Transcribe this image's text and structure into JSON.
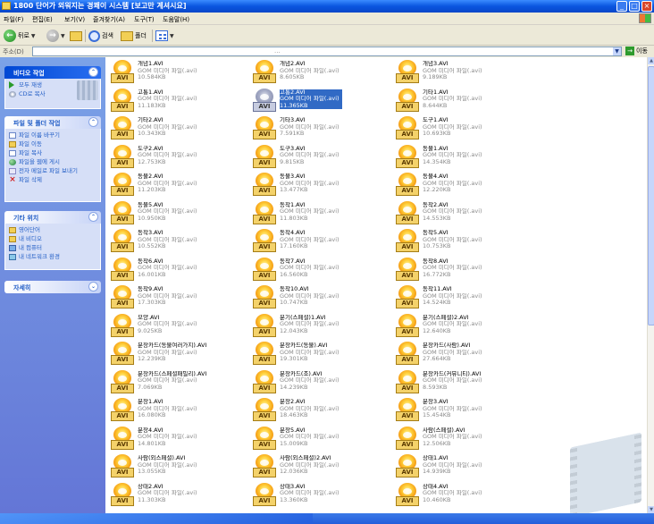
{
  "window": {
    "title": "1800 단어가 외워지는 경쾌이 시스템 [보고만 계셔시요]",
    "controls": [
      "_",
      "□",
      "×"
    ]
  },
  "menu": [
    "파일(F)",
    "편집(E)",
    "보기(V)",
    "즐겨찾기(A)",
    "도구(T)",
    "도움말(H)"
  ],
  "toolbar": {
    "back": "뒤로",
    "search": "검색",
    "folders": "폴더"
  },
  "address": {
    "label": "주소(D)",
    "value": "...",
    "go": "이동"
  },
  "taskpane": {
    "video_tasks": {
      "title": "비디오 작업",
      "items": [
        "모두 재생",
        "CD로 복사"
      ]
    },
    "file_tasks": {
      "title": "파일 및 폴더 작업",
      "items": [
        "파일 이름 바꾸기",
        "파일 이동",
        "파일 복사",
        "파일을 웹에 게시",
        "전자 메일로 파일 보내기",
        "파일 삭제"
      ]
    },
    "other_places": {
      "title": "기타 위치",
      "items": [
        "영어단어",
        "내 비디오",
        "내 컴퓨터",
        "내 네트워크 환경"
      ]
    },
    "details": {
      "title": "자세히"
    }
  },
  "file_type": "GOM 미디어 파일(.avi)",
  "icon_label": "AVI",
  "files": [
    {
      "name": "개념1.AVI",
      "size": "10.584KB"
    },
    {
      "name": "개념2.AVI",
      "size": "8.605KB"
    },
    {
      "name": "개념3.AVI",
      "size": "9.189KB"
    },
    {
      "name": "고통1.AVI",
      "size": "11.183KB"
    },
    {
      "name": "고통2.AVI",
      "size": "11.365KB",
      "selected": true
    },
    {
      "name": "기타1.AVI",
      "size": "8.644KB"
    },
    {
      "name": "기타2.AVI",
      "size": "10.343KB"
    },
    {
      "name": "기타3.AVI",
      "size": "7.591KB"
    },
    {
      "name": "도구1.AVI",
      "size": "10.693KB"
    },
    {
      "name": "도구2.AVI",
      "size": "12.753KB"
    },
    {
      "name": "도구3.AVI",
      "size": "9.815KB"
    },
    {
      "name": "동물1.AVI",
      "size": "14.354KB"
    },
    {
      "name": "동물2.AVI",
      "size": "11.203KB"
    },
    {
      "name": "동물3.AVI",
      "size": "13.477KB"
    },
    {
      "name": "동물4.AVI",
      "size": "12.220KB"
    },
    {
      "name": "동물5.AVI",
      "size": "10.950KB"
    },
    {
      "name": "동작1.AVI",
      "size": "11.803KB"
    },
    {
      "name": "동작2.AVI",
      "size": "14.553KB"
    },
    {
      "name": "동작3.AVI",
      "size": "10.552KB"
    },
    {
      "name": "동작4.AVI",
      "size": "17.160KB"
    },
    {
      "name": "동작5.AVI",
      "size": "10.753KB"
    },
    {
      "name": "동작6.AVI",
      "size": "16.001KB"
    },
    {
      "name": "동작7.AVI",
      "size": "16.560KB"
    },
    {
      "name": "동작8.AVI",
      "size": "16.772KB"
    },
    {
      "name": "동작9.AVI",
      "size": "17.303KB"
    },
    {
      "name": "동작10.AVI",
      "size": "10.747KB"
    },
    {
      "name": "동작11.AVI",
      "size": "14.524KB"
    },
    {
      "name": "모양.AVI",
      "size": "9.025KB"
    },
    {
      "name": "분기(스페셜)1.AVI",
      "size": "12.043KB"
    },
    {
      "name": "분기(스페셜)2.AVI",
      "size": "12.640KB"
    },
    {
      "name": "분장카드(동물여러가지).AVI",
      "size": "12.239KB"
    },
    {
      "name": "분장카드(동물).AVI",
      "size": "19.301KB"
    },
    {
      "name": "분장카드(사람).AVI",
      "size": "27.664KB"
    },
    {
      "name": "분장카드(스페셜패밀리).AVI",
      "size": "7.069KB"
    },
    {
      "name": "분장카드(조).AVI",
      "size": "14.239KB"
    },
    {
      "name": "분장카드(커뮤니티).AVI",
      "size": "8.593KB"
    },
    {
      "name": "분장1.AVI",
      "size": "16.080KB"
    },
    {
      "name": "분장2.AVI",
      "size": "18.463KB"
    },
    {
      "name": "분장3.AVI",
      "size": "15.454KB"
    },
    {
      "name": "분장4.AVI",
      "size": "14.801KB"
    },
    {
      "name": "분장5.AVI",
      "size": "15.009KB"
    },
    {
      "name": "사람(스페셜).AVI",
      "size": "12.506KB"
    },
    {
      "name": "사람(외스페셜).AVI",
      "size": "13.055KB"
    },
    {
      "name": "사람(외스페셜)2.AVI",
      "size": "12.036KB"
    },
    {
      "name": "상태1.AVI",
      "size": "14.939KB"
    },
    {
      "name": "상태2.AVI",
      "size": "11.303KB"
    },
    {
      "name": "상태3.AVI",
      "size": "13.360KB"
    },
    {
      "name": "상태4.AVI",
      "size": "10.460KB"
    }
  ]
}
